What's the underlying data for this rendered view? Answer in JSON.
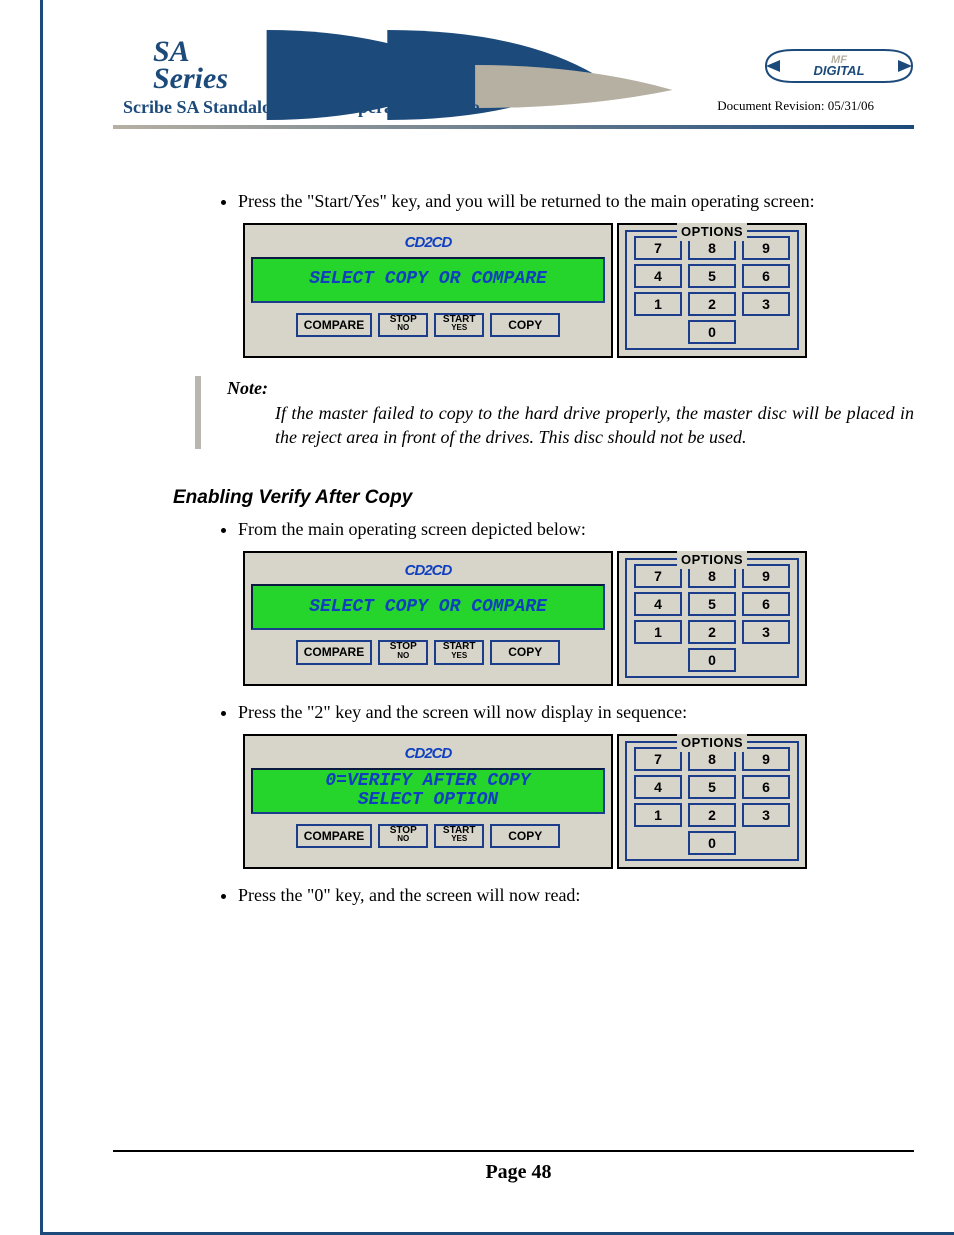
{
  "header": {
    "logo_sa": "SA",
    "logo_series": "Series",
    "guide_title": "Scribe SA Standalone Series Operator's Guide",
    "revision": "Document Revision: 05/31/06",
    "brand_logo_alt": "MF DIGITAL"
  },
  "body": {
    "bullet1": "Press the \"Start/Yes\" key, and you will be returned to the main operating screen:",
    "note_label": "Note:",
    "note_text": "If the master failed to copy to the hard drive properly, the master disc will be placed in the reject area in front of the drives. This disc  should not be used.",
    "heading1": "Enabling Verify After Copy",
    "bullet2": "From the main operating screen depicted below:",
    "bullet3": "Press the \"2\" key and the screen will now display in sequence:",
    "bullet4": "Press the \"0\" key, and the screen will now read:"
  },
  "panel": {
    "cd2cd": "CD2CD",
    "options_label": "OPTIONS",
    "buttons": {
      "compare": "COMPARE",
      "stop": "STOP",
      "stop_sub": "NO",
      "start": "START",
      "start_sub": "YES",
      "copy": "COPY"
    },
    "keypad": [
      [
        "7",
        "8",
        "9"
      ],
      [
        "4",
        "5",
        "6"
      ],
      [
        "1",
        "2",
        "3"
      ],
      [
        "0"
      ]
    ]
  },
  "screens": {
    "s1": {
      "line1": "SELECT COPY OR COMPARE",
      "line2": ""
    },
    "s2": {
      "line1": "SELECT COPY OR COMPARE",
      "line2": ""
    },
    "s3": {
      "line1": "0=VERIFY AFTER COPY",
      "line2": "SELECT OPTION"
    }
  },
  "footer": {
    "page": "Page 48"
  }
}
